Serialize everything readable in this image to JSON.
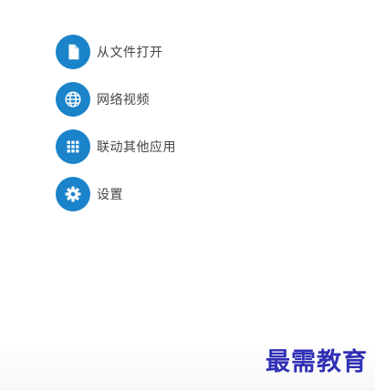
{
  "menu": {
    "items": [
      {
        "label": "从文件打开",
        "icon": "file-icon"
      },
      {
        "label": "网络视频",
        "icon": "globe-icon"
      },
      {
        "label": "联动其他应用",
        "icon": "grid-icon"
      },
      {
        "label": "设置",
        "icon": "gear-icon"
      }
    ]
  },
  "colors": {
    "accent": "#1a83c9",
    "label": "#444444",
    "watermark": "#2f2fb5"
  },
  "watermark": {
    "text": "最需教育"
  }
}
